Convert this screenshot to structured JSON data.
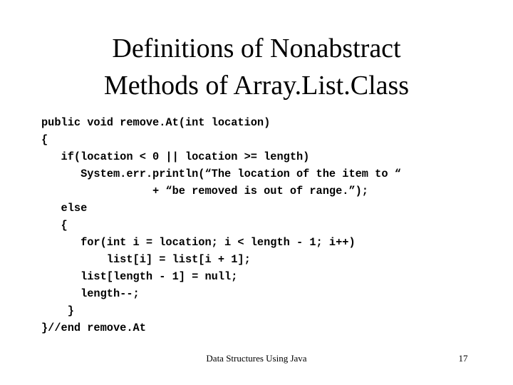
{
  "slide": {
    "background_color": "#ffffff",
    "text_color": "#000000",
    "title": {
      "line1": "Definitions of Nonabstract",
      "line2": "Methods of Array.List.Class"
    },
    "code": {
      "language": "java",
      "lines": [
        "public void remove.At(int location)",
        "{",
        "   if(location < 0 || location >= length)",
        "      System.err.println(“The location of the item to “",
        "                 + “be removed is out of range.”);",
        "   else",
        "   {",
        "      for(int i = location; i < length - 1; i++)",
        "          list[i] = list[i + 1];",
        "      list[length - 1] = null;",
        "      length--;",
        "    }",
        "}//end remove.At"
      ]
    },
    "footer": {
      "source": "Data Structures Using Java",
      "page_number": "17"
    }
  }
}
